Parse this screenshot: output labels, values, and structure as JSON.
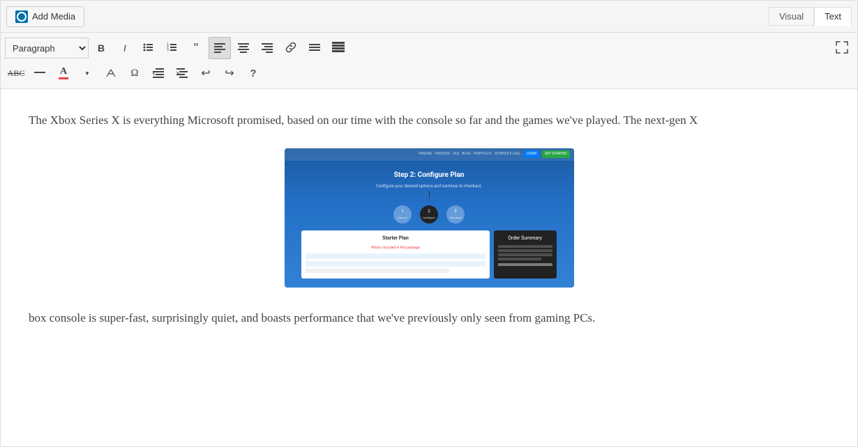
{
  "toolbar": {
    "add_media_label": "Add Media",
    "tab_visual": "Visual",
    "tab_text": "Text",
    "paragraph_label": "Paragraph",
    "buttons_row1": [
      {
        "name": "bold",
        "symbol": "B",
        "title": "Bold"
      },
      {
        "name": "italic",
        "symbol": "I",
        "title": "Italic"
      },
      {
        "name": "unordered-list",
        "symbol": "≡•",
        "title": "Unordered List"
      },
      {
        "name": "ordered-list",
        "symbol": "≡1",
        "title": "Ordered List"
      },
      {
        "name": "blockquote",
        "symbol": "❝",
        "title": "Blockquote"
      },
      {
        "name": "align-left",
        "symbol": "≡",
        "title": "Align Left",
        "active": true
      },
      {
        "name": "align-center",
        "symbol": "≡c",
        "title": "Align Center"
      },
      {
        "name": "align-right",
        "symbol": "≡r",
        "title": "Align Right"
      },
      {
        "name": "link",
        "symbol": "🔗",
        "title": "Insert Link"
      },
      {
        "name": "horizontal-rule",
        "symbol": "—",
        "title": "Horizontal Rule"
      },
      {
        "name": "toolbar-toggle",
        "symbol": "⊞",
        "title": "Toolbar Toggle"
      }
    ],
    "buttons_row2": [
      {
        "name": "strikethrough",
        "symbol": "abc̶",
        "title": "Strikethrough"
      },
      {
        "name": "hr",
        "symbol": "—",
        "title": "Horizontal Line"
      },
      {
        "name": "text-color",
        "symbol": "A",
        "title": "Text Color"
      },
      {
        "name": "clear-formatting",
        "symbol": "◇",
        "title": "Clear Formatting"
      },
      {
        "name": "special-char",
        "symbol": "Ω",
        "title": "Special Characters"
      },
      {
        "name": "indent-left",
        "symbol": "⇤",
        "title": "Outdent"
      },
      {
        "name": "indent-right",
        "symbol": "⇥",
        "title": "Indent"
      },
      {
        "name": "undo",
        "symbol": "↩",
        "title": "Undo"
      },
      {
        "name": "redo",
        "symbol": "↪",
        "title": "Redo"
      },
      {
        "name": "help",
        "symbol": "?",
        "title": "Keyboard Shortcuts"
      }
    ]
  },
  "content": {
    "paragraph1": "The Xbox Series X is everything Microsoft promised, based on our time with the console so far and the games we've played. The next-gen X",
    "paragraph2": "box console is super-fast, surprisingly quiet, and boasts performance that we've previously only seen from gaming PCs.",
    "image_alt": "Step 2: Configure Plan screenshot",
    "screenshot": {
      "title": "Step 2: Configure Plan",
      "subtitle": "Configure your desired options and continue to checkout.",
      "steps": [
        {
          "num": "1",
          "label": "Choose",
          "active": false
        },
        {
          "num": "2",
          "label": "Configure",
          "active": true
        },
        {
          "num": "3",
          "label": "Checkout",
          "active": false
        }
      ],
      "card_title": "Starter Plan",
      "card_sub": "What's Included in this package",
      "summary_title": "Order Summary"
    }
  }
}
